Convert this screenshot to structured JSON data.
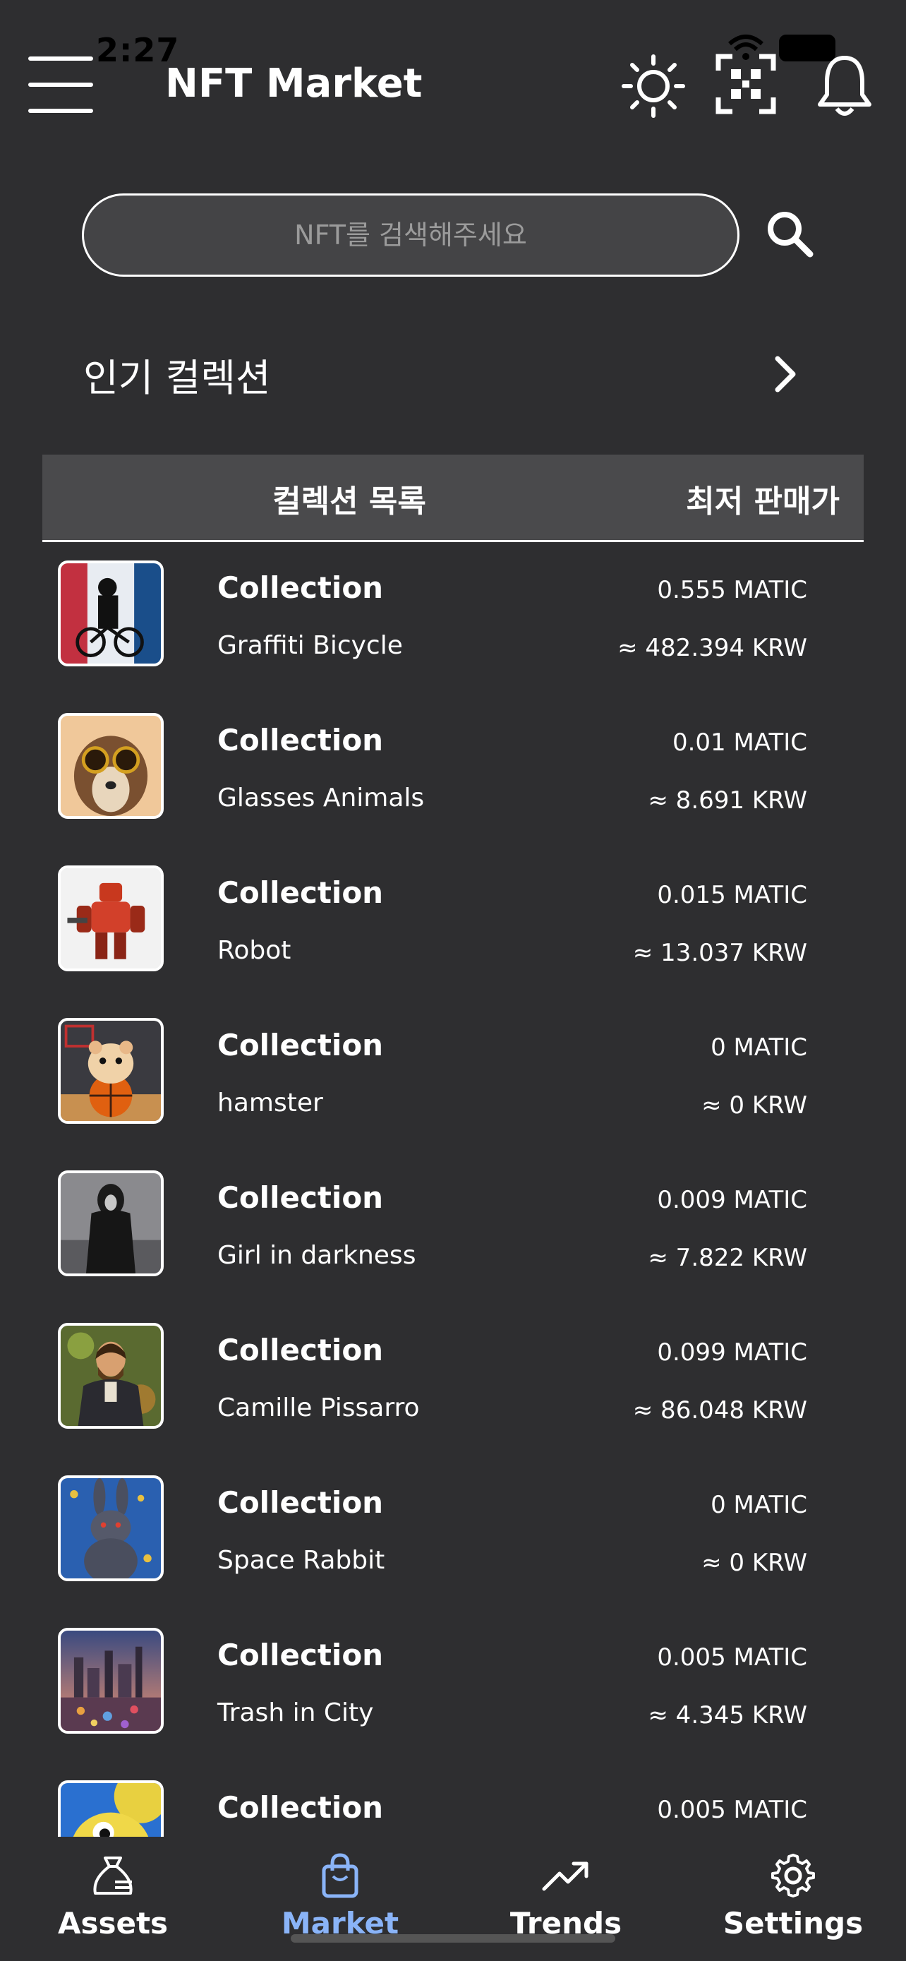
{
  "status": {
    "time": "2:27"
  },
  "header": {
    "title": "NFT Market"
  },
  "search": {
    "placeholder": "NFT를 검색해주세요"
  },
  "section": {
    "title": "인기 컬렉션"
  },
  "table": {
    "col_left": "컬렉션 목록",
    "col_right": "최저 판매가"
  },
  "collections": [
    {
      "label": "Collection",
      "name": "Graffiti Bicycle",
      "price": "0.555 MATIC",
      "krw": "≈ 482.394 KRW"
    },
    {
      "label": "Collection",
      "name": "Glasses Animals",
      "price": "0.01 MATIC",
      "krw": "≈ 8.691 KRW"
    },
    {
      "label": "Collection",
      "name": "Robot",
      "price": "0.015 MATIC",
      "krw": "≈ 13.037 KRW"
    },
    {
      "label": "Collection",
      "name": "hamster",
      "price": "0 MATIC",
      "krw": "≈ 0 KRW"
    },
    {
      "label": "Collection",
      "name": "Girl in darkness",
      "price": "0.009 MATIC",
      "krw": "≈ 7.822 KRW"
    },
    {
      "label": "Collection",
      "name": "Camille Pissarro",
      "price": "0.099 MATIC",
      "krw": "≈ 86.048 KRW"
    },
    {
      "label": "Collection",
      "name": "Space Rabbit",
      "price": "0 MATIC",
      "krw": "≈ 0 KRW"
    },
    {
      "label": "Collection",
      "name": "Trash in City",
      "price": "0.005 MATIC",
      "krw": "≈ 4.345 KRW"
    },
    {
      "label": "Collection",
      "name": "",
      "price": "0.005 MATIC",
      "krw": ""
    }
  ],
  "tabs": [
    {
      "label": "Assets",
      "icon": "money-bag-icon"
    },
    {
      "label": "Market",
      "icon": "shopping-bag-icon",
      "active": true
    },
    {
      "label": "Trends",
      "icon": "trending-up-icon"
    },
    {
      "label": "Settings",
      "icon": "gear-icon"
    }
  ],
  "colors": {
    "background": "#2e2e30",
    "header_row": "#4a4a4c",
    "active_tab": "#8ab4f8"
  }
}
